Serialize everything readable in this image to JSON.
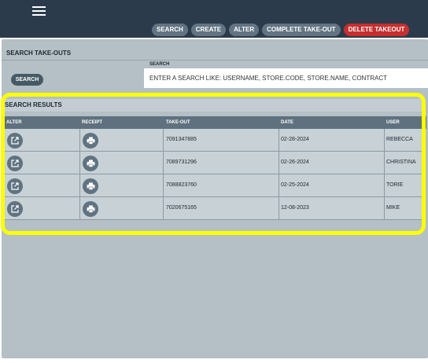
{
  "toolbar": {
    "search": "SEARCH",
    "create": "CREATE",
    "alter": "ALTER",
    "complete": "COMPLETE TAKE-OUT",
    "delete": "DELETE TAKEOUT"
  },
  "search_section": {
    "title": "SEARCH TAKE-OUTS",
    "button": "SEARCH",
    "field_label": "SEARCH",
    "placeholder": "ENTER A SEARCH LIKE: USERNAME, STORE.CODE, STORE.NAME, CONTRACT"
  },
  "results": {
    "title": "SEARCH RESULTS",
    "columns": [
      "ALTER",
      "RECEIPT",
      "TAKE-OUT",
      "DATE",
      "USER"
    ],
    "rows": [
      {
        "takeout": "7091347885",
        "date": "02-28-2024",
        "user": "REBECCA"
      },
      {
        "takeout": "7089731296",
        "date": "02-26-2024",
        "user": "CHRISTINA"
      },
      {
        "takeout": "7088823760",
        "date": "02-25-2024",
        "user": "TORIE"
      },
      {
        "takeout": "7020675165",
        "date": "12-08-2023",
        "user": "MIKE"
      }
    ]
  },
  "colors": {
    "topbar": "#2b3b4c",
    "panel": "#b4bfc6",
    "highlight": "#fbff00",
    "danger": "#c62f2f"
  },
  "icons": {
    "menu": "hamburger-menu-icon",
    "alter": "open-in-new-icon",
    "receipt": "printer-icon"
  }
}
